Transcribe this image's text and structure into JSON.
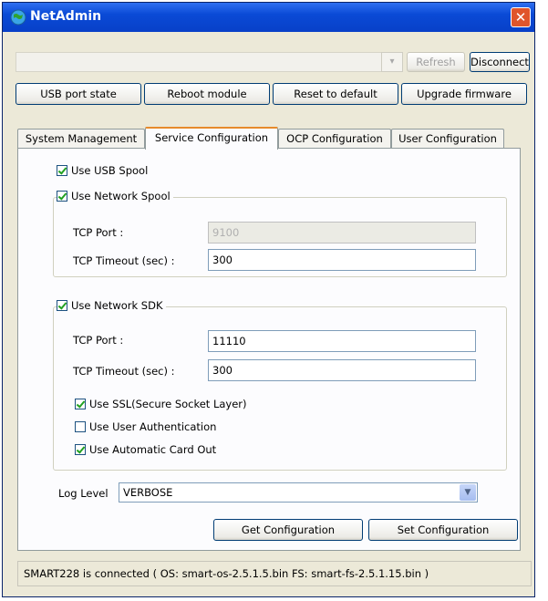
{
  "window": {
    "title": "NetAdmin",
    "close_glyph": "✕"
  },
  "connection": {
    "refresh_label": "Refresh",
    "disconnect_label": "Disconnect",
    "dropdown_glyph": "▾"
  },
  "actions": {
    "usb_port_state": "USB port state",
    "reboot_module": "Reboot module",
    "reset_to_default": "Reset to default",
    "upgrade_firmware": "Upgrade firmware"
  },
  "tabs": [
    {
      "label": "System Management",
      "active": false
    },
    {
      "label": "Service Configuration",
      "active": true
    },
    {
      "label": "OCP Configuration",
      "active": false
    },
    {
      "label": "User Configuration",
      "active": false
    }
  ],
  "service": {
    "use_usb_spool": {
      "label": "Use USB Spool",
      "checked": true
    },
    "network_spool": {
      "label": "Use Network Spool",
      "checked": true,
      "tcp_port_label": "TCP Port :",
      "tcp_port_value": "9100",
      "tcp_timeout_label": "TCP Timeout (sec) :",
      "tcp_timeout_value": "300"
    },
    "network_sdk": {
      "label": "Use Network SDK",
      "checked": true,
      "tcp_port_label": "TCP Port :",
      "tcp_port_value": "11110",
      "tcp_timeout_label": "TCP Timeout (sec) :",
      "tcp_timeout_value": "300",
      "use_ssl": {
        "label": "Use SSL(Secure Socket Layer)",
        "checked": true
      },
      "use_user_auth": {
        "label": "Use User Authentication",
        "checked": false
      },
      "use_auto_card_out": {
        "label": "Use Automatic Card Out",
        "checked": true
      }
    },
    "log_level_label": "Log Level",
    "log_level_value": "VERBOSE",
    "get_config_label": "Get Configuration",
    "set_config_label": "Set Configuration"
  },
  "status_text": "SMART228 is connected ( OS: smart-os-2.5.1.5.bin  FS: smart-fs-2.5.1.15.bin )",
  "icons": {
    "title": "network-globe-icon",
    "dropdown": "chevron-down-icon"
  },
  "colors": {
    "titlebar": "#0a4ad6",
    "close": "#e0552b",
    "tab_active_accent": "#e68b2c",
    "check": "#21a121"
  }
}
